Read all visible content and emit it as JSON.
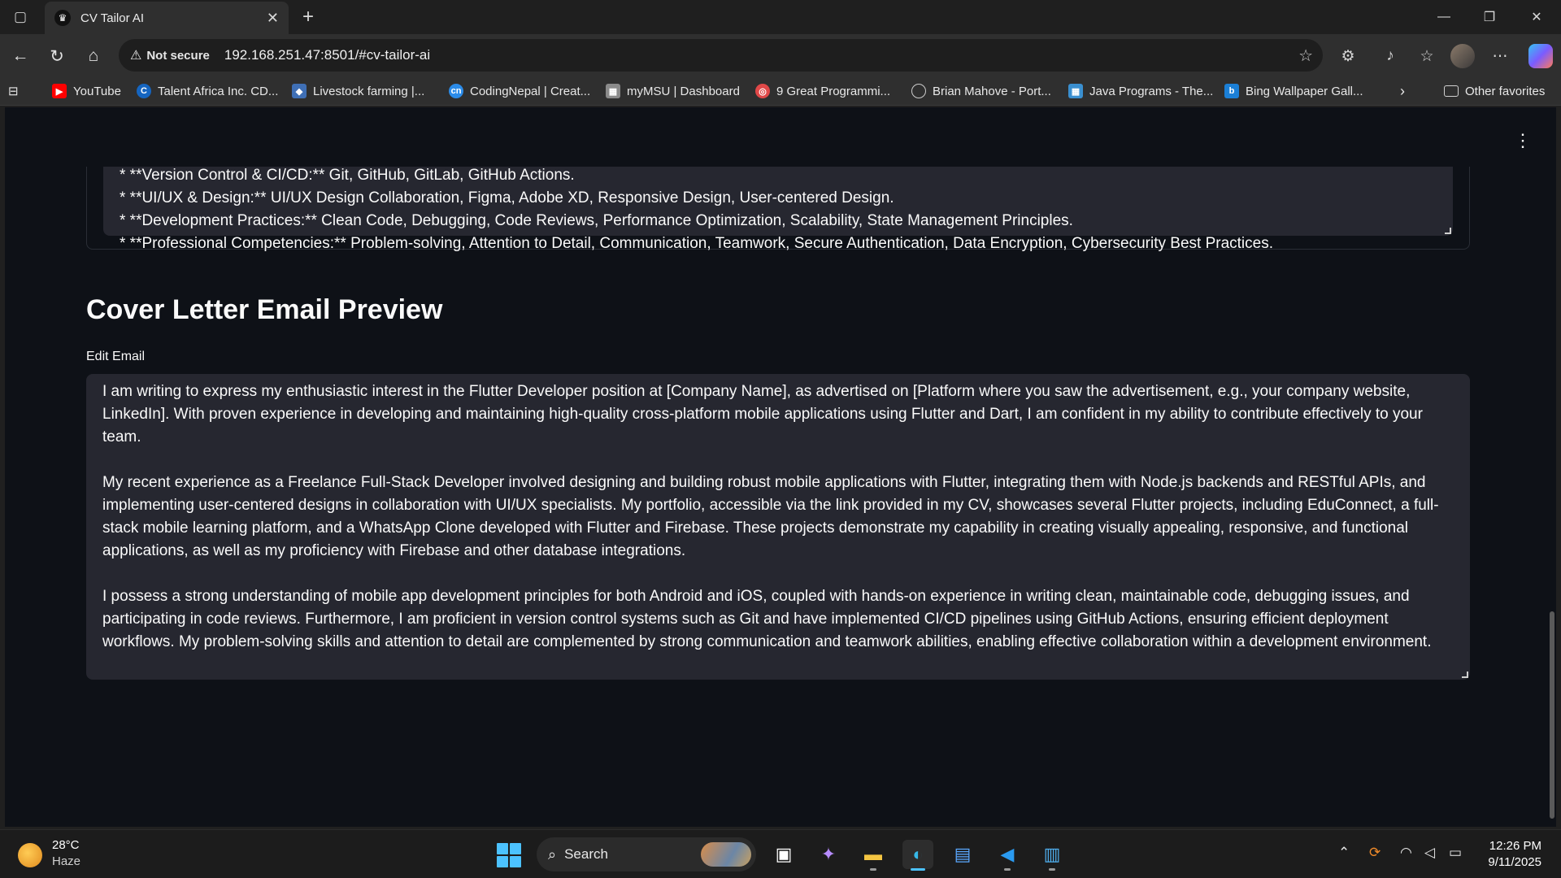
{
  "browser": {
    "tab_title": "CV Tailor AI",
    "security_label": "Not secure",
    "url": "192.168.251.47:8501/#cv-tailor-ai",
    "bookmarks": [
      {
        "label": "YouTube"
      },
      {
        "label": "Talent Africa Inc. CD..."
      },
      {
        "label": "Livestock farming |..."
      },
      {
        "label": "CodingNepal | Creat..."
      },
      {
        "label": "myMSU | Dashboard"
      },
      {
        "label": "9 Great Programmi..."
      },
      {
        "label": "Brian Mahove - Port..."
      },
      {
        "label": "Java Programs - The..."
      },
      {
        "label": "Bing Wallpaper Gall..."
      }
    ],
    "other_favorites": "Other favorites"
  },
  "skills": {
    "lines": [
      "*   **Version Control & CI/CD:** Git, GitHub, GitLab, GitHub Actions.",
      "*   **UI/UX & Design:** UI/UX Design Collaboration, Figma, Adobe XD, Responsive Design, User-centered Design.",
      "*   **Development Practices:** Clean Code, Debugging, Code Reviews, Performance Optimization, Scalability, State Management Principles.",
      "*   **Professional Competencies:** Problem-solving, Attention to Detail, Communication, Teamwork, Secure Authentication, Data Encryption, Cybersecurity Best Practices."
    ]
  },
  "cover_letter": {
    "heading": "Cover Letter Email Preview",
    "field_label": "Edit Email",
    "paragraphs": [
      "I am writing to express my enthusiastic interest in the Flutter Developer position at [Company Name], as advertised on [Platform where you saw the advertisement, e.g., your company website, LinkedIn]. With proven experience in developing and maintaining high-quality cross-platform mobile applications using Flutter and Dart, I am confident in my ability to contribute effectively to your team.",
      "My recent experience as a Freelance Full-Stack Developer involved designing and building robust mobile applications with Flutter, integrating them with Node.js backends and RESTful APIs, and implementing user-centered designs in collaboration with UI/UX specialists. My portfolio, accessible via the link provided in my CV, showcases several Flutter projects, including EduConnect, a full-stack mobile learning platform, and a WhatsApp Clone developed with Flutter and Firebase. These projects demonstrate my capability in creating visually appealing, responsive, and functional applications, as well as my proficiency with Firebase and other database integrations.",
      "I possess a strong understanding of mobile app development principles for both Android and iOS, coupled with hands-on experience in writing clean, maintainable code, debugging issues, and participating in code reviews. Furthermore, I am proficient in version control systems such as Git and have implemented CI/CD pipelines using GitHub Actions, ensuring efficient deployment workflows. My problem-solving skills and attention to detail are complemented by strong communication and teamwork abilities, enabling effective collaboration within a development environment."
    ]
  },
  "taskbar": {
    "temperature": "28°C",
    "weather": "Haze",
    "search_label": "Search",
    "time": "12:26 PM",
    "date": "9/11/2025"
  }
}
